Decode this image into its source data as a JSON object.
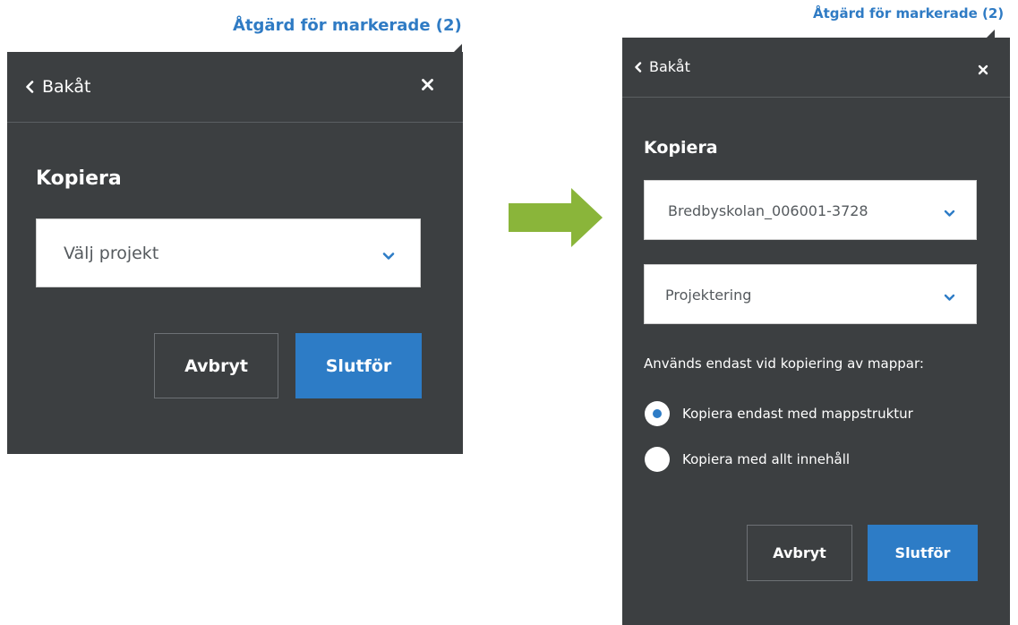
{
  "before": {
    "trigger_label": "Åtgärd för markerade (2)",
    "back_label": "Bakåt",
    "close_glyph": "×",
    "section_title": "Kopiera",
    "project_select": {
      "value": "Välj projekt",
      "icon": "chevron-down-icon"
    },
    "cancel_label": "Avbryt",
    "finish_label": "Slutför"
  },
  "arrow": {
    "icon": "right-arrow-icon",
    "color": "#8ab53a"
  },
  "after": {
    "trigger_label": "Åtgärd för markerade (2)",
    "back_label": "Bakåt",
    "close_glyph": "×",
    "section_title": "Kopiera",
    "project_select": {
      "value": "Bredbyskolan_006001-3728",
      "icon": "chevron-down-icon"
    },
    "folder_select": {
      "value": "Projektering",
      "icon": "chevron-down-icon"
    },
    "note": "Används endast vid kopiering av mappar:",
    "radio_options": [
      {
        "label": "Kopiera endast med mappstruktur",
        "checked": true
      },
      {
        "label": "Kopiera med allt innehåll",
        "checked": false
      }
    ],
    "cancel_label": "Avbryt",
    "finish_label": "Slutför"
  },
  "colors": {
    "panel_bg": "#3c3f41",
    "accent_blue": "#2d7cc6",
    "link_blue": "#2f7bc4"
  }
}
